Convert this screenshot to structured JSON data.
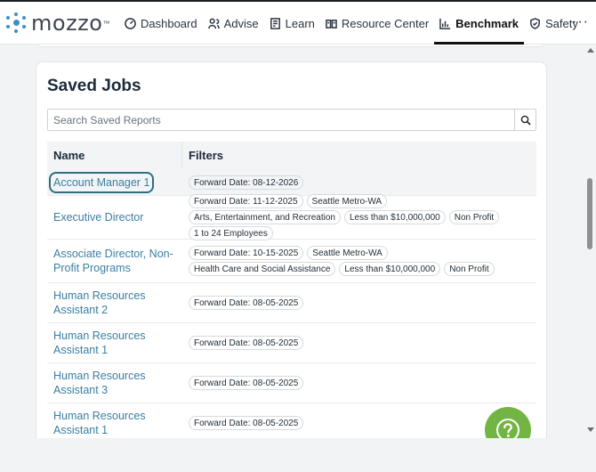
{
  "app": {
    "logo_text": "mozzo",
    "logo_mark": "™"
  },
  "nav": [
    {
      "label": "Dashboard",
      "icon": "dashboard-gauge-icon",
      "active": false
    },
    {
      "label": "Advise",
      "icon": "people-icon",
      "active": false
    },
    {
      "label": "Learn",
      "icon": "book-icon",
      "active": false
    },
    {
      "label": "Resource Center",
      "icon": "open-book-icon",
      "active": false
    },
    {
      "label": "Benchmark",
      "icon": "bar-chart-icon",
      "active": true
    },
    {
      "label": "Safety",
      "icon": "shield-icon",
      "active": false
    }
  ],
  "nav_more": "···",
  "page": {
    "title": "Saved Jobs",
    "search_placeholder": "Search Saved Reports"
  },
  "table": {
    "headers": {
      "name": "Name",
      "filters": "Filters"
    },
    "rows": [
      {
        "name": "Account Manager 1",
        "filters": [
          "Forward Date: 08-12-2026"
        ],
        "focused": true
      },
      {
        "name": "Executive Director",
        "filters": [
          "Forward Date: 11-12-2025",
          "Seattle Metro-WA",
          "Arts, Entertainment, and Recreation",
          "Less than $10,000,000",
          "Non Profit",
          "1 to 24 Employees"
        ]
      },
      {
        "name": "Associate Director, Non-Profit Programs",
        "filters": [
          "Forward Date: 10-15-2025",
          "Seattle Metro-WA",
          "Health Care and Social Assistance",
          "Less than $10,000,000",
          "Non Profit"
        ]
      },
      {
        "name": "Human Resources Assistant 2",
        "filters": [
          "Forward Date: 08-05-2025"
        ]
      },
      {
        "name": "Human Resources Assistant 1",
        "filters": [
          "Forward Date: 08-05-2025"
        ]
      },
      {
        "name": "Human Resources Assistant 3",
        "filters": [
          "Forward Date: 08-05-2025"
        ]
      },
      {
        "name": "Human Resources Assistant 1",
        "filters": [
          "Forward Date: 08-05-2025"
        ]
      }
    ]
  },
  "colors": {
    "accent": "#3a7fa3",
    "help_button": "#73b544",
    "brand": "#3a8fc7"
  }
}
